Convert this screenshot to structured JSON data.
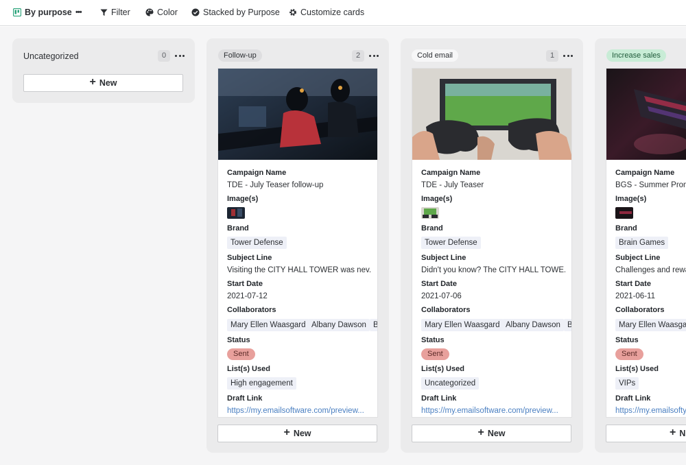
{
  "toolbar": {
    "view_label": "By purpose",
    "more_label": "•••",
    "filter_label": "Filter",
    "color_label": "Color",
    "stacked_label": "Stacked by Purpose",
    "customize_label": "Customize cards",
    "icons": [
      "board-icon",
      "more-icon",
      "filter-icon",
      "palette-icon",
      "check-circle-icon",
      "gear-icon"
    ]
  },
  "columns": [
    {
      "title": "Uncategorized",
      "count": "0",
      "new_label": "New"
    },
    {
      "title": "Follow-up",
      "count": "2",
      "new_label": "New",
      "pill_color": "#e4e4e6"
    },
    {
      "title": "Cold email",
      "count": "1",
      "new_label": "New",
      "pill_color": "#f4f4f5"
    },
    {
      "title": "Increase sales",
      "count": "",
      "new_label": "N",
      "pill_color": "#c8ecd6"
    }
  ],
  "fields": {
    "campaign": "Campaign Name",
    "images": "Image(s)",
    "brand": "Brand",
    "subject": "Subject Line",
    "start": "Start Date",
    "collaborators": "Collaborators",
    "status": "Status",
    "lists": "List(s) Used",
    "draft": "Draft Link"
  },
  "cards": [
    {
      "campaign_name": "TDE - July Teaser follow-up",
      "brand": "Tower Defense",
      "subject_line": "Visiting the CITY HALL TOWER was nev...",
      "start_date": "2021-07-12",
      "collaborators": [
        "Mary Ellen Waasgard",
        "Albany Dawson",
        "B"
      ],
      "status": "Sent",
      "list_used": "High engagement",
      "draft_link": "https://my.emailsoftware.com/preview..."
    },
    {
      "campaign_name": "TDE - July Teaser",
      "brand": "Tower Defense",
      "subject_line": "Didn't you know? The CITY HALL TOWE...",
      "start_date": "2021-07-06",
      "collaborators": [
        "Mary Ellen Waasgard",
        "Albany Dawson",
        "B"
      ],
      "status": "Sent",
      "list_used": "Uncategorized",
      "draft_link": "https://my.emailsoftware.com/preview..."
    },
    {
      "campaign_name": "BGS - Summer Prom",
      "brand": "Brain Games",
      "subject_line": "Challenges and rewa",
      "start_date": "2021-06-11",
      "collaborators": [
        "Mary Ellen Waasgar"
      ],
      "status": "Sent",
      "list_used": "VIPs",
      "draft_link": "https://my.emailsofty"
    }
  ]
}
